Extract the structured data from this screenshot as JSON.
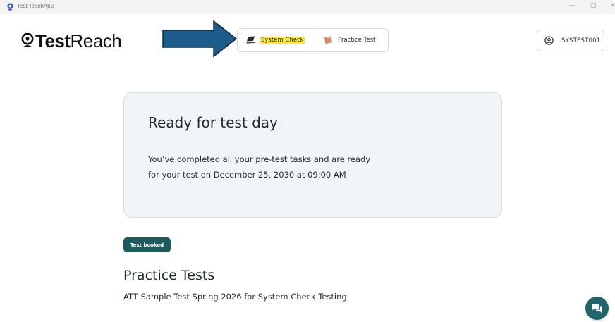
{
  "window": {
    "title": "TestReachApp",
    "minimize_glyph": "—",
    "maximize_glyph": "▢",
    "close_glyph": "✕"
  },
  "logo": {
    "bold": "Test",
    "light": "Reach",
    "icon": "camera-badge-icon"
  },
  "toolbar": {
    "system_check_label": "System Check",
    "system_check_icon": "laptop-icon",
    "practice_test_label": "Practice Test",
    "practice_test_icon": "book-icon",
    "highlight_color": "#ffeb3b"
  },
  "user": {
    "username": "SYSTEST001",
    "icon": "user-circle-icon"
  },
  "status_card": {
    "title": "Ready for test day",
    "body": "You’ve completed all your pre-test tasks and are ready for your test on December 25, 2030 at 09:00 AM"
  },
  "badge": {
    "label": "Test booked",
    "color": "#1d5a5e"
  },
  "practice_tests": {
    "title": "Practice Tests",
    "items": [
      {
        "label": "ATT Sample Test Spring 2026 for System Check Testing"
      }
    ]
  },
  "chat": {
    "icon": "chat-bubbles-icon",
    "color": "#21656a"
  },
  "annotation": {
    "arrow_color": "#1c5b8a",
    "arrow_icon": "arrow-right-icon"
  }
}
